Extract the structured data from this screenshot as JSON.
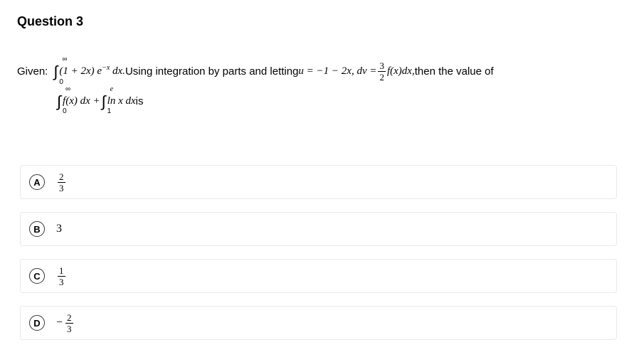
{
  "question": {
    "title": "Question 3",
    "given_label": "Given:",
    "integral1_upper": "∞",
    "integral1_lower": "0",
    "integral1_body": "(1 + 2x) e",
    "integral1_exp": "−x",
    "integral1_dx": " dx.",
    "using_text": " Using integration by parts and letting ",
    "u_eq": "u = −1 − 2x,  dv = ",
    "frac_dv_num": "3",
    "frac_dv_den": "2",
    "fx_text": "f(x)dx,",
    "then_text": " then the value of",
    "integral2_upper": "∞",
    "integral2_lower": "0",
    "integral2_body": " f(x) dx + ",
    "integral3_upper": "e",
    "integral3_lower": "1",
    "integral3_body": " ln x dx",
    "is_text": " is"
  },
  "options": {
    "A": {
      "letter": "A",
      "type": "frac",
      "neg": false,
      "num": "2",
      "den": "3"
    },
    "B": {
      "letter": "B",
      "type": "plain",
      "value": "3"
    },
    "C": {
      "letter": "C",
      "type": "frac",
      "neg": false,
      "num": "1",
      "den": "3"
    },
    "D": {
      "letter": "D",
      "type": "frac",
      "neg": true,
      "num": "2",
      "den": "3"
    }
  }
}
